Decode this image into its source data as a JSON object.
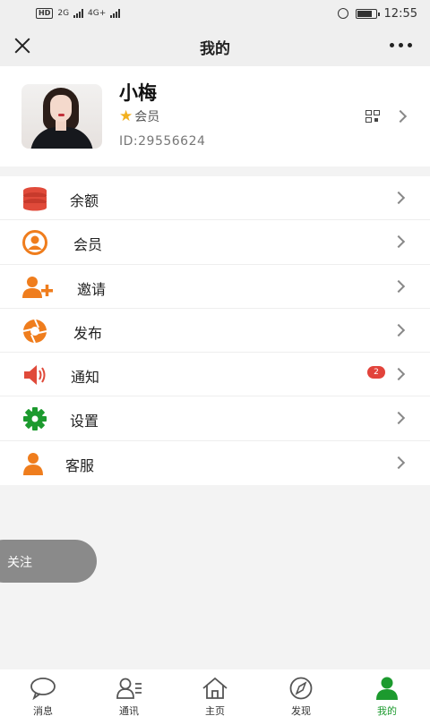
{
  "status_bar": {
    "network_badge": "HD",
    "net1": "2G",
    "net2": "4G+",
    "time": "12:55"
  },
  "nav": {
    "title": "我的"
  },
  "profile": {
    "name": "小梅",
    "member_label": "会员",
    "id_text": "ID:29556624"
  },
  "menu": [
    {
      "label": "余额",
      "icon": "database-icon",
      "color": "#e04a3a"
    },
    {
      "label": "会员",
      "icon": "user-circle-icon",
      "color": "#ef7d1d"
    },
    {
      "label": "邀请",
      "icon": "add-user-icon",
      "color": "#ef7d1d"
    },
    {
      "label": "发布",
      "icon": "aperture-icon",
      "color": "#ef7d1d"
    },
    {
      "label": "通知",
      "icon": "speaker-icon",
      "color": "#e04a3a",
      "badge": "2"
    },
    {
      "label": "设置",
      "icon": "gear-icon",
      "color": "#1c9a2e"
    },
    {
      "label": "客服",
      "icon": "person-icon",
      "color": "#ef7d1d"
    }
  ],
  "follow_button": "关注",
  "tabbar": [
    {
      "label": "消息",
      "icon": "chat-bubble-icon"
    },
    {
      "label": "通讯",
      "icon": "contacts-icon"
    },
    {
      "label": "主页",
      "icon": "home-icon"
    },
    {
      "label": "发现",
      "icon": "compass-icon"
    },
    {
      "label": "我的",
      "icon": "profile-icon",
      "active": true
    }
  ],
  "colors": {
    "accent_green": "#1c9a2e",
    "accent_orange": "#ef7d1d",
    "accent_red": "#e04a3a"
  }
}
